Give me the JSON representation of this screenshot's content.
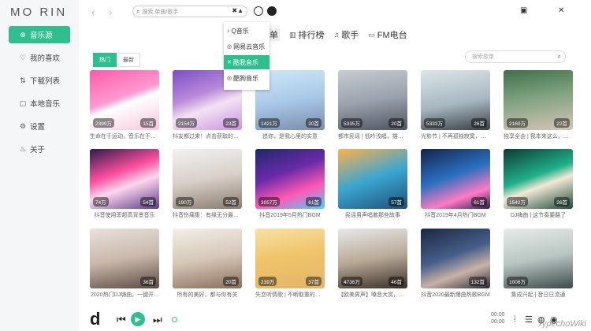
{
  "app": {
    "logo": "MO RIN"
  },
  "sidebar": {
    "items": [
      {
        "icon": "⊕",
        "label": "音乐源",
        "active": true
      },
      {
        "icon": "♡",
        "label": "我的喜欢"
      },
      {
        "icon": "⇅",
        "label": "下载列表"
      },
      {
        "icon": "▢",
        "label": "本地音乐"
      },
      {
        "icon": "⚙",
        "label": "设置"
      },
      {
        "icon": "♨",
        "label": "关于"
      }
    ]
  },
  "topbar": {
    "back": "‹",
    "forward": "›",
    "search_placeholder": "搜索 单曲/歌手",
    "dropdown_toggle": "✖▲",
    "minimize": "▣",
    "close": "✕"
  },
  "source_dropdown": {
    "items": [
      {
        "icon": "♪",
        "label": "Q音乐"
      },
      {
        "icon": "◎",
        "label": "网易云音乐"
      },
      {
        "icon": "✕",
        "label": "酷我音乐",
        "active": true
      },
      {
        "icon": "◎",
        "label": "酷狗音乐"
      }
    ]
  },
  "tabs": [
    {
      "icon": "",
      "label": "单"
    },
    {
      "icon": "▥",
      "label": "排行榜"
    },
    {
      "icon": "♫",
      "label": "歌手"
    },
    {
      "icon": "▭",
      "label": "FM电台"
    }
  ],
  "filters": [
    "热门",
    "最新"
  ],
  "list_search_placeholder": "搜索歌单",
  "playlists": [
    {
      "plays": "2399万",
      "count": "15首",
      "caption": "生命在于运动，音乐在于节..."
    },
    {
      "plays": "2154万",
      "count": "23首",
      "caption": "抖友都过来！点击获取的门..."
    },
    {
      "plays": "1421万",
      "count": "20首",
      "caption": "追你，是我心里的实意"
    },
    {
      "plays": "5335万",
      "count": "20首",
      "caption": "都市民谣 | 低吟浅唱，描述..."
    },
    {
      "plays": "5333万",
      "count": "26首",
      "caption": "光影节 | 不再孤独寂寞，不吐..."
    },
    {
      "plays": "2160万",
      "count": "22首",
      "caption": "独享全会 | 我本来这么，刻画..."
    },
    {
      "plays": "74万",
      "count": "54首",
      "caption": "抖音使用率超高背景音乐"
    },
    {
      "plays": "190万",
      "count": "52首",
      "caption": "抖音伤痛集：有缘无分最是..."
    },
    {
      "plays": "3057万",
      "count": "61首",
      "caption": "抖音2019年5月热门BGM"
    },
    {
      "plays": "",
      "count": "57首",
      "caption": "民谣男声唱着那些故事"
    },
    {
      "plays": "",
      "count": "61首",
      "caption": "抖音2019年4月热门BGM"
    },
    {
      "plays": "1542万",
      "count": "26首",
      "caption": "DJ嗨曲 | 这节奏要翻了"
    },
    {
      "plays": "",
      "count": "36首",
      "caption": "2020热门DJ嗨曲，一键开..."
    },
    {
      "plays": "",
      "count": "20首",
      "caption": "所有的美好，都与你有关"
    },
    {
      "plays": "239万",
      "count": "37首",
      "caption": "失恋听情歌 | 不断取重的泪..."
    },
    {
      "plays": "4736万",
      "count": "46首",
      "caption": "【欧美男声】嗓音大赏，最..."
    },
    {
      "plays": "",
      "count": "132首",
      "caption": "抖音2020最新爆曲热歌BGM"
    },
    {
      "plays": "1006万",
      "count": "",
      "caption": "集成兴起 | 音日日流通"
    }
  ],
  "player": {
    "logo": "d",
    "prev": "⏮",
    "play": "▶",
    "next": "⏭",
    "time_current": "00:00",
    "time_total": "00:00"
  },
  "watermark": "TypechoWiki"
}
